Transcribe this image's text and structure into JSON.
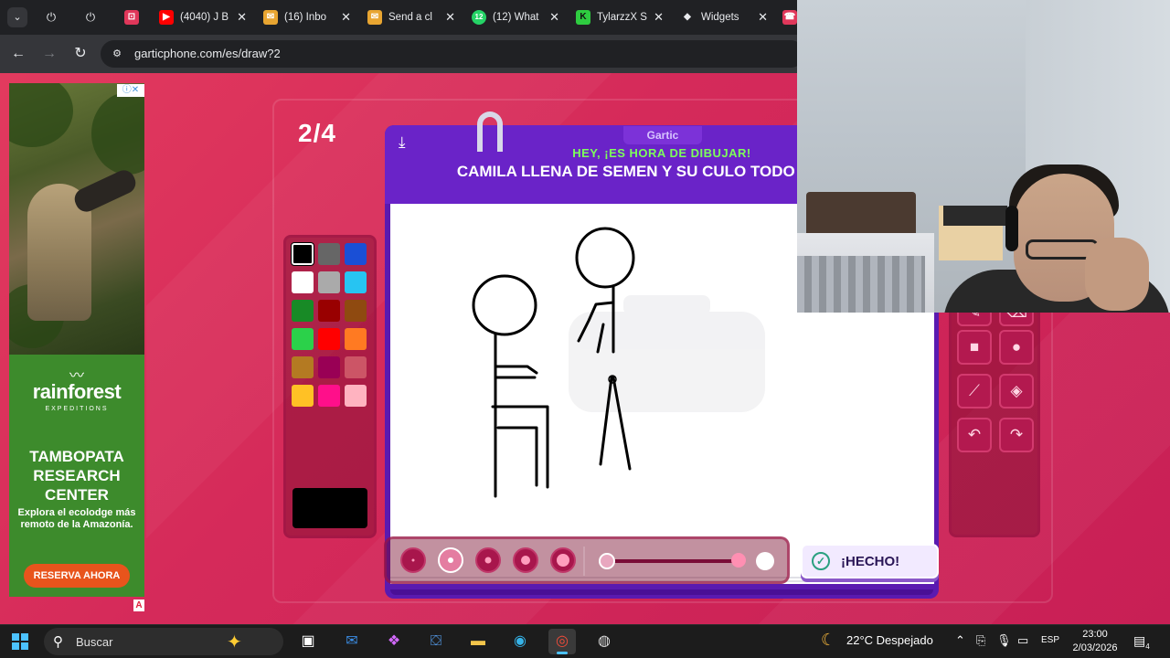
{
  "browser": {
    "tabs": [
      {
        "title": "(4040) J B",
        "favicon_color": "#ff0000",
        "favicon": "▶"
      },
      {
        "title": "(16) Inbo",
        "favicon_color": "#e8a531",
        "favicon": "✉"
      },
      {
        "title": "Send a cl",
        "favicon_color": "#e8a531",
        "favicon": "✉"
      },
      {
        "title": "(12) What",
        "favicon_color": "#25d366",
        "favicon": "12"
      },
      {
        "title": "TylarzzX S",
        "favicon_color": "#2ecc40",
        "favicon": "K"
      },
      {
        "title": "Widgets",
        "favicon_color": "#e8eaed",
        "favicon": "◆"
      }
    ],
    "url": "garticphone.com/es/draw?2"
  },
  "ad": {
    "choices": "ⓘ✕",
    "bird": "〰︎",
    "brand": "rainforest",
    "brand_sub": "EXPEDITIONS",
    "headline": "TAMBOPATA RESEARCH CENTER",
    "body": "Explora el ecolodge más remoto de la Amazonía.",
    "cta": "RESERVA AHORA",
    "badge": "A"
  },
  "game": {
    "round": "2/4",
    "brand": "Gartic",
    "instruction": "HEY, ¡ES HORA DE DIBUJAR!",
    "prompt": "CAMILA LLENA DE SEMEN Y SU CULO TODO GRANDE",
    "done_label": "¡HECHO!",
    "selected_color": "#000000",
    "selected_brush_size": 2,
    "palette": [
      "#000000",
      "#666666",
      "#1a4fd6",
      "#ffffff",
      "#aaaaaa",
      "#27c4f2",
      "#188a26",
      "#990000",
      "#8f4a10",
      "#2bd14a",
      "#ff0000",
      "#ff7a22",
      "#b47a22",
      "#990055",
      "#cc5566",
      "#ffc125",
      "#ff0f8a",
      "#ffb3c0"
    ],
    "tools": [
      "pen-icon",
      "eraser-icon",
      "rect-icon",
      "ellipse-icon",
      "line-icon",
      "fill-icon",
      "undo-icon",
      "redo-icon"
    ]
  },
  "taskbar": {
    "search_placeholder": "Buscar",
    "weather": "22°C  Despejado",
    "lang": "ESP",
    "time": "23:00",
    "date": "2/03/2026",
    "notif_count": "4"
  }
}
